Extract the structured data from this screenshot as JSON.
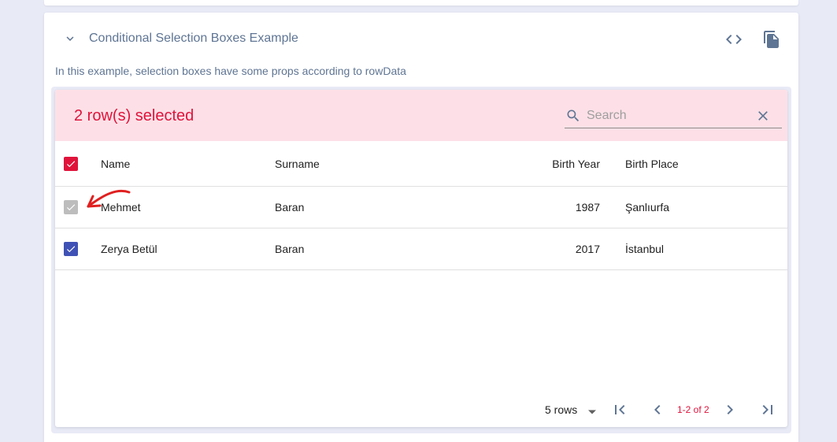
{
  "section": {
    "title": "Conditional Selection Boxes Example",
    "description": "In this example, selection boxes have some props according to rowData"
  },
  "toolbar": {
    "selected_text": "2 row(s) selected",
    "search_placeholder": "Search",
    "search_value": ""
  },
  "table": {
    "columns": [
      "Name",
      "Surname",
      "Birth Year",
      "Birth Place"
    ],
    "rows": [
      {
        "name": "Mehmet",
        "surname": "Baran",
        "birth_year": "1987",
        "birth_place": "Şanlıurfa",
        "checked": true,
        "disabled": true
      },
      {
        "name": "Zerya Betül",
        "surname": "Baran",
        "birth_year": "2017",
        "birth_place": "İstanbul",
        "checked": true,
        "disabled": false
      }
    ]
  },
  "pagination": {
    "rows_per_page": "5 rows",
    "range": "1-2 of 2"
  },
  "colors": {
    "accent": "#e0133b",
    "toolbar_bg": "#fde0e7",
    "checkbox_enabled": "#3f51b5",
    "checkbox_disabled": "#bdbdbd",
    "annotation": "#e02020"
  }
}
